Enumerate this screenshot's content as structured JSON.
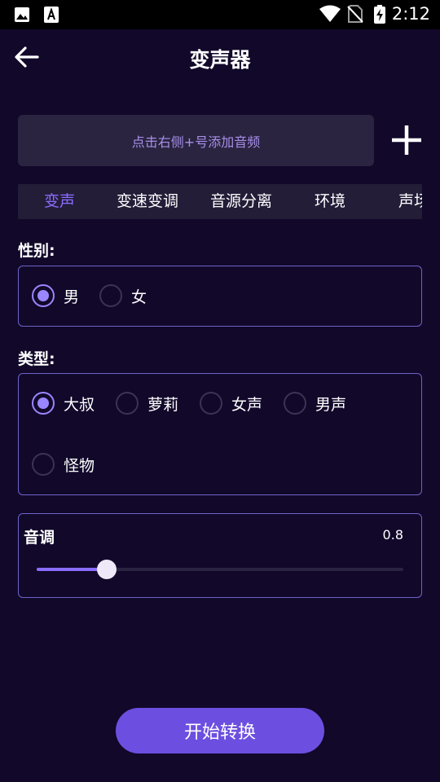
{
  "status_bar": {
    "time": "2:12",
    "icons": [
      "image-icon",
      "font-download-icon",
      "wifi-icon",
      "no-sim-icon",
      "battery-charging-icon"
    ]
  },
  "app_bar": {
    "title": "变声器",
    "back_icon": "arrow-left-icon"
  },
  "audio_picker": {
    "placeholder": "点击右侧+号添加音频",
    "add_icon": "plus-icon"
  },
  "tabs": [
    {
      "label": "变声",
      "active": true
    },
    {
      "label": "变速变调",
      "active": false
    },
    {
      "label": "音源分离",
      "active": false
    },
    {
      "label": "环境",
      "active": false
    },
    {
      "label": "声场",
      "active": false
    }
  ],
  "gender": {
    "label": "性别:",
    "options": [
      {
        "label": "男",
        "checked": true
      },
      {
        "label": "女",
        "checked": false
      }
    ]
  },
  "type": {
    "label": "类型:",
    "options": [
      {
        "label": "大叔",
        "checked": true
      },
      {
        "label": "萝莉",
        "checked": false
      },
      {
        "label": "女声",
        "checked": false
      },
      {
        "label": "男声",
        "checked": false
      },
      {
        "label": "怪物",
        "checked": false
      }
    ]
  },
  "pitch": {
    "label": "音调",
    "value_text": "0.8",
    "fill_fraction": 0.19
  },
  "convert_button": {
    "label": "开始转换"
  },
  "colors": {
    "background": "#12082a",
    "accent": "#8b6cff",
    "button": "#6c4fe0",
    "panel_border": "#6f63c8",
    "input_bg": "#2a2440"
  }
}
